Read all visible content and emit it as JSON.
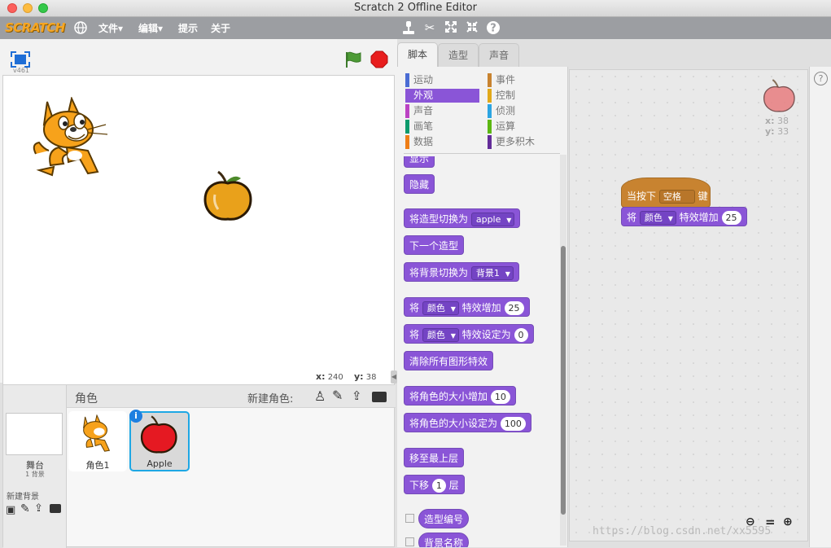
{
  "window": {
    "title": "Scratch 2 Offline Editor"
  },
  "menubar": {
    "logo": "SCRATCH",
    "items": [
      "文件▾",
      "编辑▾",
      "提示",
      "关于"
    ]
  },
  "stage": {
    "version": "v461",
    "mouse_x_label": "x:",
    "mouse_x": "240",
    "mouse_y_label": "y:",
    "mouse_y": "38"
  },
  "tabs": [
    "脚本",
    "造型",
    "声音"
  ],
  "categories": [
    {
      "label": "运动",
      "color": "#4a6cd4"
    },
    {
      "label": "事件",
      "color": "#c88330"
    },
    {
      "label": "外观",
      "color": "#8a55d7"
    },
    {
      "label": "控制",
      "color": "#e1a91a"
    },
    {
      "label": "声音",
      "color": "#bb42c3"
    },
    {
      "label": "侦测",
      "color": "#2ca5e2"
    },
    {
      "label": "画笔",
      "color": "#0e9a6c"
    },
    {
      "label": "运算",
      "color": "#5cb712"
    },
    {
      "label": "数据",
      "color": "#ee7d16"
    },
    {
      "label": "更多积木",
      "color": "#632d99"
    }
  ],
  "blocks": {
    "show": "显示",
    "hide": "隐藏",
    "switch_costume_prefix": "将造型切换为",
    "switch_costume_value": "apple",
    "next_costume": "下一个造型",
    "switch_backdrop_prefix": "将背景切换为",
    "switch_backdrop_value": "背景1",
    "change_effect_prefix": "将",
    "change_effect_value": "颜色",
    "change_effect_mid": "特效增加",
    "change_effect_num": "25",
    "set_effect_prefix": "将",
    "set_effect_value": "颜色",
    "set_effect_mid": "特效设定为",
    "set_effect_num": "0",
    "clear_effects": "清除所有图形特效",
    "change_size": "将角色的大小增加",
    "change_size_num": "10",
    "set_size": "将角色的大小设定为",
    "set_size_num": "100",
    "go_front": "移至最上层",
    "go_back_prefix": "下移",
    "go_back_num": "1",
    "go_back_suffix": "层",
    "costume_num": "造型编号",
    "backdrop_name": "背景名称"
  },
  "script": {
    "hat_prefix": "当按下",
    "hat_key": "空格",
    "hat_suffix": "键",
    "cmd_prefix": "将",
    "cmd_value": "颜色",
    "cmd_mid": "特效增加",
    "cmd_num": "25"
  },
  "sprite_info": {
    "x_label": "x:",
    "x": "38",
    "y_label": "y:",
    "y": "33"
  },
  "sprite_panel": {
    "title": "角色",
    "new_sprite_label": "新建角色:",
    "stage_label": "舞台",
    "stage_sub": "1 背景",
    "new_backdrop": "新建背景",
    "sprites": [
      {
        "name": "角色1"
      },
      {
        "name": "Apple"
      }
    ]
  },
  "watermark": "https://blog.csdn.net/xx5595"
}
